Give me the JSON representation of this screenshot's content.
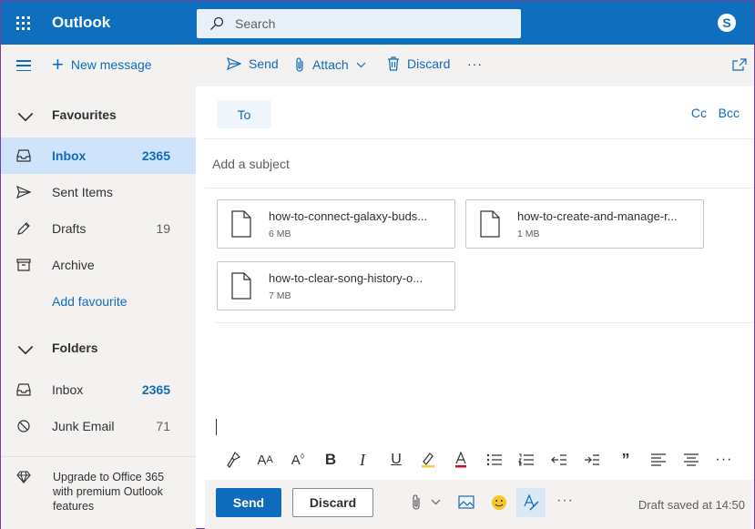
{
  "app": {
    "title": "Outlook"
  },
  "search": {
    "placeholder": "Search"
  },
  "colors": {
    "brand": "#106ebe",
    "accent": "#0f6cbd",
    "selected": "#cfe4fa",
    "sidebar_bg": "#f3f2f1"
  },
  "toolbar": {
    "new_message": "New message",
    "send": "Send",
    "attach": "Attach",
    "discard": "Discard",
    "more": "···"
  },
  "sidebar": {
    "favourites": {
      "label": "Favourites"
    },
    "fav_items": [
      {
        "label": "Inbox",
        "count": "2365",
        "icon": "inbox-icon"
      },
      {
        "label": "Sent Items",
        "count": "",
        "icon": "send-icon"
      },
      {
        "label": "Drafts",
        "count": "19",
        "icon": "pencil-icon"
      },
      {
        "label": "Archive",
        "count": "",
        "icon": "archive-icon"
      }
    ],
    "add_favourite": "Add favourite",
    "folders": {
      "label": "Folders"
    },
    "folder_items": [
      {
        "label": "Inbox",
        "count": "2365",
        "icon": "inbox-icon"
      },
      {
        "label": "Junk Email",
        "count": "71",
        "icon": "blocked-icon"
      }
    ],
    "upgrade": "Upgrade to Office 365 with premium Outlook features"
  },
  "compose": {
    "to_label": "To",
    "cc_label": "Cc",
    "bcc_label": "Bcc",
    "subject_placeholder": "Add a subject",
    "attachments": [
      {
        "name": "how-to-connect-galaxy-buds...",
        "size": "6 MB"
      },
      {
        "name": "how-to-create-and-manage-r...",
        "size": "1 MB"
      },
      {
        "name": "how-to-clear-song-history-o...",
        "size": "7 MB"
      }
    ]
  },
  "send_bar": {
    "send": "Send",
    "discard": "Discard",
    "more": "···",
    "status": "Draft saved at 14:50"
  }
}
